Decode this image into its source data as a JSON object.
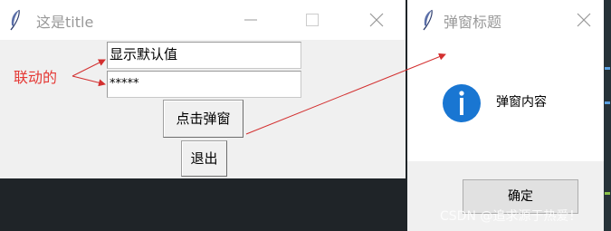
{
  "main_window": {
    "title": "这是title",
    "entry_text": "显示默认值",
    "entry_password": "*****",
    "popup_button": "点击弹窗",
    "exit_button": "退出"
  },
  "annotation": {
    "label": "联动的",
    "color": "#e53935"
  },
  "dialog": {
    "title": "弹窗标题",
    "message": "弹窗内容",
    "ok_button": "确定",
    "icon": "info-icon",
    "icon_color": "#1976d2"
  },
  "watermark": "CSDN @追求源于热爱！"
}
